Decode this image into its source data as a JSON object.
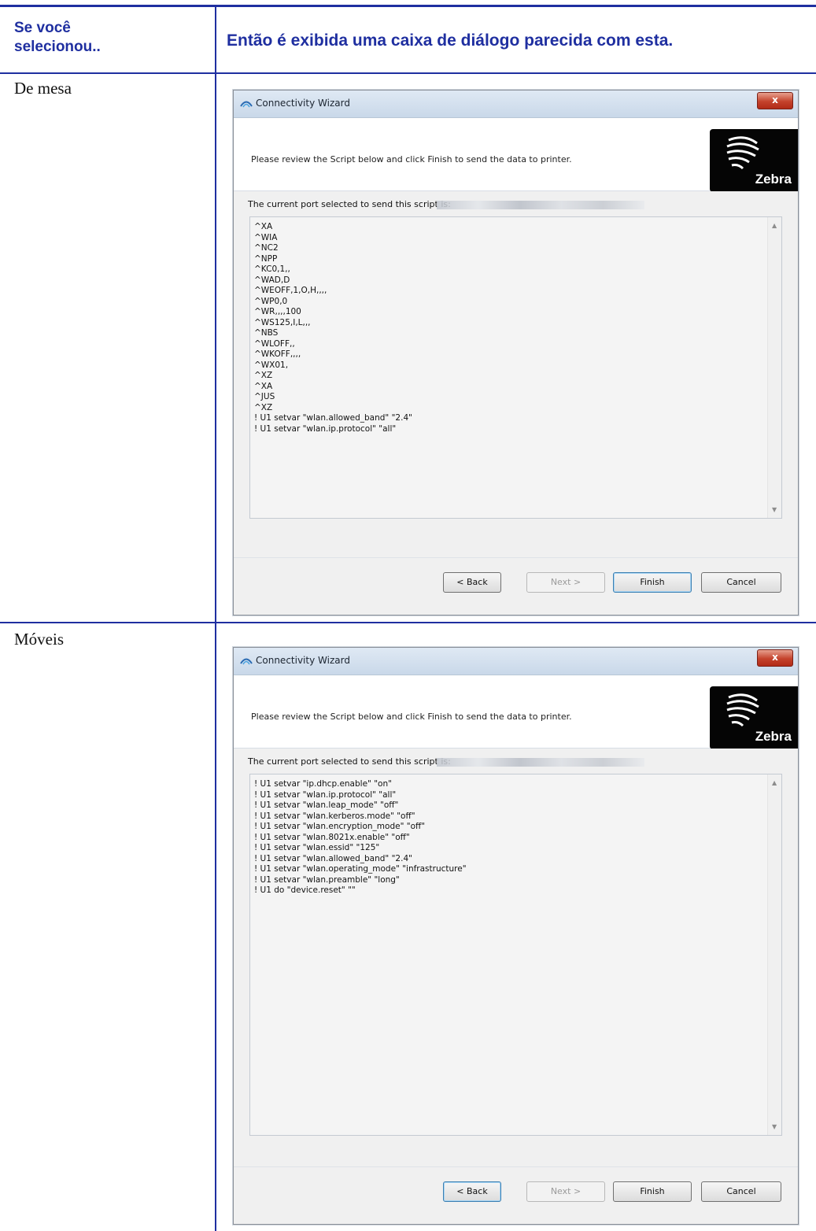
{
  "header": {
    "col1": "Se você\nselecionou..",
    "col2": "Então é exibida uma caixa de diálogo parecida com esta."
  },
  "rows": [
    {
      "label": "De mesa",
      "dialog": {
        "title": "Connectivity Wizard",
        "close_label": "x",
        "message": "Please review the Script below and click Finish to send the data to printer.",
        "logo_text": "Zebra",
        "port_label": "The current port selected to send this script is:",
        "script": "^XA\n^WIA\n^NC2\n^NPP\n^KC0,1,,\n^WAD,D\n^WEOFF,1,O,H,,,,\n^WP0,0\n^WR,,,,100\n^WS125,I,L,,,\n^NBS\n^WLOFF,,\n^WKOFF,,,,\n^WX01,\n^XZ\n^XA\n^JUS\n^XZ\n! U1 setvar \"wlan.allowed_band\" \"2.4\"\n! U1 setvar \"wlan.ip.protocol\" \"all\"",
        "buttons": {
          "back": "< Back",
          "next": "Next >",
          "finish": "Finish",
          "cancel": "Cancel"
        }
      }
    },
    {
      "label": "Móveis",
      "dialog": {
        "title": "Connectivity Wizard",
        "close_label": "x",
        "message": "Please review the Script below and click Finish to send the data to printer.",
        "logo_text": "Zebra",
        "port_label": "The current port selected to send this script is:",
        "script": "! U1 setvar \"ip.dhcp.enable\" \"on\"\n! U1 setvar \"wlan.ip.protocol\" \"all\"\n! U1 setvar \"wlan.leap_mode\" \"off\"\n! U1 setvar \"wlan.kerberos.mode\" \"off\"\n! U1 setvar \"wlan.encryption_mode\" \"off\"\n! U1 setvar \"wlan.8021x.enable\" \"off\"\n! U1 setvar \"wlan.essid\" \"125\"\n! U1 setvar \"wlan.allowed_band\" \"2.4\"\n! U1 setvar \"wlan.operating_mode\" \"infrastructure\"\n! U1 setvar \"wlan.preamble\" \"long\"\n! U1 do \"device.reset\" \"\"",
        "buttons": {
          "back": "< Back",
          "next": "Next >",
          "finish": "Finish",
          "cancel": "Cancel"
        }
      }
    }
  ]
}
